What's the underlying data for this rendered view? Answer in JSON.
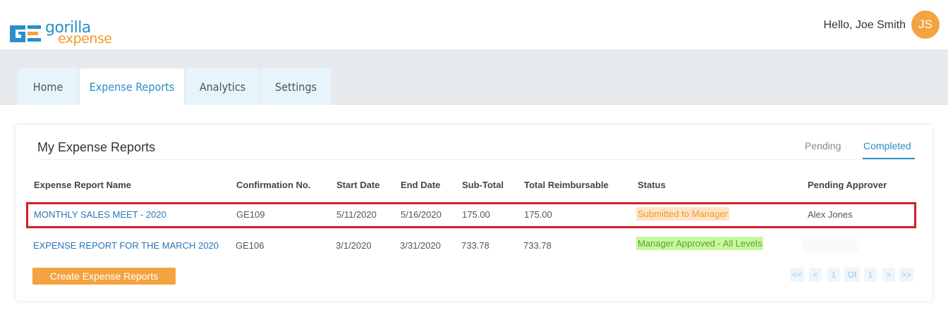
{
  "header": {
    "logo_line1": "gorilla",
    "logo_line2": "expense",
    "greeting": "Hello, Joe Smith",
    "avatar_initials": "JS"
  },
  "tabs": [
    {
      "label": "Home",
      "active": false
    },
    {
      "label": "Expense Reports",
      "active": true
    },
    {
      "label": "Analytics",
      "active": false
    },
    {
      "label": "Settings",
      "active": false
    }
  ],
  "card": {
    "title": "My Expense Reports",
    "subtabs": [
      {
        "label": "Pending",
        "active": false
      },
      {
        "label": "Completed",
        "active": true
      }
    ]
  },
  "table": {
    "headers": [
      "Expense Report Name",
      "Confirmation No.",
      "Start Date",
      "End Date",
      "Sub-Total",
      "Total Reimbursable",
      "Status",
      "Pending Approver"
    ],
    "rows": [
      {
        "name": "MONTHLY SALES MEET - 2020",
        "confirmation": "GE109",
        "start": "5/11/2020",
        "end": "5/16/2020",
        "subtotal": "175.00",
        "reimbursable": "175.00",
        "status": "Submitted to Manager",
        "approver": "Alex Jones",
        "highlighted": true
      },
      {
        "name": "EXPENSE REPORT FOR THE MARCH 2020",
        "confirmation": "GE106",
        "start": "3/1/2020",
        "end": "3/31/2020",
        "subtotal": "733.78",
        "reimbursable": "733.78",
        "status": "Manager Approved - All Levels",
        "approver": "",
        "highlighted": false
      }
    ]
  },
  "actions": {
    "create_label": "Create Expense Reports"
  },
  "pagination": {
    "first": "<<",
    "prev": "<",
    "current": "1",
    "of": "Of",
    "total": "1",
    "next": ">",
    "last": ">>"
  },
  "colors": {
    "brand_blue": "#2a8fc9",
    "brand_orange": "#f4a340",
    "highlight_red": "#d0202a",
    "status_submitted": "#f29b26",
    "status_approved": "#59a327"
  }
}
